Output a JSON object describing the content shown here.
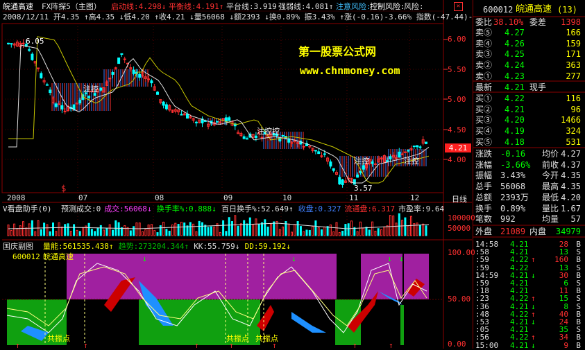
{
  "main": {
    "title": "皖通高速",
    "indicator": "FX阵探5（主图）",
    "params": [
      {
        "label": "启动线:",
        "value": "4.298",
        "arrow": "↓",
        "color": "#ff3030"
      },
      {
        "label": "平衡线:",
        "value": "4.191",
        "arrow": "↑",
        "color": "#ff3030"
      },
      {
        "label": "平台线:",
        "value": "3.919",
        "arrow": "",
        "color": "#e0e0e0"
      },
      {
        "label": "强弱线:",
        "value": "4.081",
        "arrow": "↑",
        "color": "#e0e0e0"
      },
      {
        "label": "注意风险:",
        "value": "",
        "arrow": "",
        "color": "#40c0ff"
      },
      {
        "label": "控制风险:",
        "value": "",
        "arrow": "",
        "color": "#ffffff"
      },
      {
        "label": "风险:",
        "value": "",
        "arrow": "",
        "color": "#e0e0e0"
      }
    ],
    "ohlc_line": "2008/12/11  开4.35 ↑高4.35 ↓低4.20 ↑收4.21 ↓量56068 ↓额2393 ↓换0.89% 振3.43% ↑涨(-0.16)-3.66% 指数(-47.44)-",
    "watermark_title": "第一股票公式网",
    "watermark_url": "www.chnmoney.com",
    "labels": {
      "high": "6.05",
      "low": "3.57",
      "current_price": "4.21"
    },
    "annotations": [
      "注控",
      "注控控",
      "注控",
      "注控"
    ],
    "price_axis": [
      "6.00",
      "5.50",
      "5.00",
      "4.50",
      "4.00"
    ],
    "date_axis": [
      "2008",
      "07",
      "08",
      "09",
      "10",
      "11",
      "12"
    ],
    "period": "日线"
  },
  "volume": {
    "title": "V看盘助手(0)",
    "items": [
      {
        "text": "预测成交:0",
        "color": "#e0e0e0"
      },
      {
        "text": "成交:56068",
        "color": "#ff40ff",
        "arrow": "↓"
      },
      {
        "text": "换手率%:0.888",
        "color": "#00ff00",
        "arrow": "↓"
      },
      {
        "text": "百日换手%:52.649",
        "color": "#e0e0e0",
        "arrow": "↑"
      },
      {
        "text": "收盘:0.327",
        "color": "#4080ff"
      },
      {
        "text": "流通盘:6.317",
        "color": "#ff3030"
      },
      {
        "text": "市盈率:9.64",
        "color": "#e0e0e0"
      }
    ],
    "axis": [
      "100000",
      "50000"
    ]
  },
  "sub": {
    "title": "国庆副图",
    "items": [
      {
        "text": "量能:561535.438",
        "color": "#ffff00",
        "arrow": "↑"
      },
      {
        "text": "趋势:273204.344",
        "color": "#00c000",
        "arrow": "↑"
      },
      {
        "text": "KK:55.759",
        "color": "#e0e0e0",
        "arrow": "↓"
      },
      {
        "text": "DD:59.192",
        "color": "#ffff00",
        "arrow": "↓"
      }
    ],
    "code": "600012",
    "name": "皖通高速",
    "signal_label": "共振点",
    "axis": [
      "100.00",
      "50.00",
      "0.00"
    ]
  },
  "panel": {
    "code": "600012",
    "name": "皖通高速",
    "suffix": "(13)",
    "weibi_label": "委比",
    "weibi": "38.10%",
    "weicha_label": "委差",
    "weicha": "1398",
    "asks": [
      {
        "label": "卖⑤",
        "price": "4.27",
        "vol": "166"
      },
      {
        "label": "卖④",
        "price": "4.26",
        "vol": "159"
      },
      {
        "label": "卖③",
        "price": "4.25",
        "vol": "171"
      },
      {
        "label": "卖②",
        "price": "4.24",
        "vol": "363"
      },
      {
        "label": "卖①",
        "price": "4.23",
        "vol": "277"
      }
    ],
    "last_label": "最新",
    "last": "4.21",
    "hand_label": "现手",
    "bids": [
      {
        "label": "买①",
        "price": "4.22",
        "vol": "116"
      },
      {
        "label": "买②",
        "price": "4.21",
        "vol": "96"
      },
      {
        "label": "买③",
        "price": "4.20",
        "vol": "1466"
      },
      {
        "label": "买④",
        "price": "4.19",
        "vol": "324"
      },
      {
        "label": "买⑤",
        "price": "4.18",
        "vol": "531"
      }
    ],
    "stats": [
      {
        "l1": "涨跌",
        "v1": "-0.16",
        "l2": "均价",
        "v2": "4.27"
      },
      {
        "l1": "涨幅",
        "v1": "-3.66%",
        "l2": "前收",
        "v2": "4.37"
      },
      {
        "l1": "振幅",
        "v1": "3.43%",
        "l2": "今开",
        "v2": "4.35"
      },
      {
        "l1": "总手",
        "v1": "56068",
        "l2": "最高",
        "v2": "4.35"
      },
      {
        "l1": "总额",
        "v1": "2393万",
        "l2": "最低",
        "v2": "4.20"
      },
      {
        "l1": "换手",
        "v1": "0.89%",
        "l2": "量比",
        "v2": "1.67"
      },
      {
        "l1": "笔数",
        "v1": "992",
        "l2": "均量",
        "v2": "57"
      }
    ],
    "outer_label": "外盘",
    "outer": "21089",
    "inner_label": "内盘",
    "inner": "34979",
    "ticks": [
      {
        "time": "14:58",
        "price": "4.21",
        "arrow": "",
        "vol": "28",
        "side": "B"
      },
      {
        "time": ":58",
        "price": "4.21",
        "arrow": "",
        "vol": "13",
        "side": "S"
      },
      {
        "time": ":59",
        "price": "4.22",
        "arrow": "↑",
        "vol": "160",
        "side": "B"
      },
      {
        "time": ":59",
        "price": "4.22",
        "arrow": "",
        "vol": "13",
        "side": "S"
      },
      {
        "time": "14:59",
        "price": "4.21",
        "arrow": "↓",
        "vol": "30",
        "side": "B"
      },
      {
        "time": ":59",
        "price": "4.21",
        "arrow": "",
        "vol": "6",
        "side": "S"
      },
      {
        "time": ":18",
        "price": "4.21",
        "arrow": "",
        "vol": "11",
        "side": "B"
      },
      {
        "time": ":23",
        "price": "4.22",
        "arrow": "↑",
        "vol": "15",
        "side": "S"
      },
      {
        "time": ":36",
        "price": "4.21",
        "arrow": "↓",
        "vol": "8",
        "side": "S"
      },
      {
        "time": ":48",
        "price": "4.22",
        "arrow": "↑",
        "vol": "40",
        "side": "B"
      },
      {
        "time": ":53",
        "price": "4.21",
        "arrow": "↓",
        "vol": "24",
        "side": "B"
      },
      {
        "time": ":05",
        "price": "4.21",
        "arrow": "",
        "vol": "35",
        "side": "S"
      },
      {
        "time": ":56",
        "price": "4.22",
        "arrow": "↑",
        "vol": "34",
        "side": "B"
      },
      {
        "time": "15:00",
        "price": "4.21",
        "arrow": "↓",
        "vol": "9",
        "side": "B"
      }
    ]
  }
}
